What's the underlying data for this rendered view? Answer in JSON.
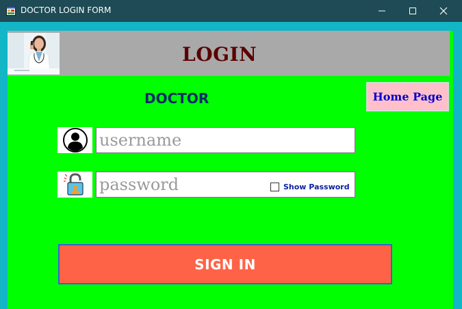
{
  "window": {
    "title": "DOCTOR LOGIN FORM",
    "app_icon": "form-window-icon",
    "controls": [
      "minimize-icon",
      "maximize-icon",
      "close-icon"
    ]
  },
  "header": {
    "title": "LOGIN",
    "image": "doctor-photo"
  },
  "form": {
    "heading": "DOCTOR",
    "home_button_label": "Home Page",
    "username": {
      "value": "",
      "placeholder": "username",
      "icon": "user-icon"
    },
    "password": {
      "value": "",
      "placeholder": "password",
      "icon": "lock-icon"
    },
    "show_password": {
      "label": "Show Password",
      "checked": false
    },
    "signin_label": "SIGN IN"
  },
  "colors": {
    "titlebar": "#1e4b55",
    "frame": "#12b6c6",
    "form_background": "#00ff00",
    "header_band": "#a9a9a9",
    "login_title": "#5a0000",
    "doctor_heading": "#0b2a6b",
    "home_button_bg": "#ffc0cb",
    "home_button_text": "#0000cc",
    "signin_bg": "#ff6347",
    "signin_border": "#3c5ed8"
  }
}
